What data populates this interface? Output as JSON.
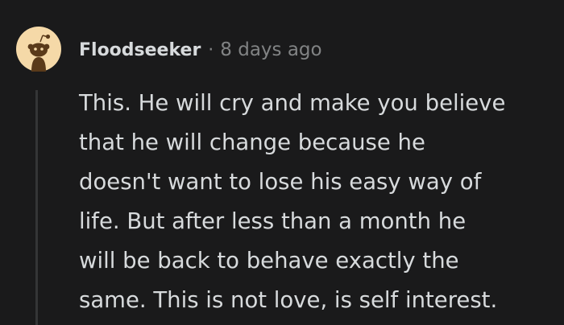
{
  "comment": {
    "avatar_icon": "snoo-avatar-icon",
    "author": "Floodseeker",
    "separator": "·",
    "timestamp": "8 days ago",
    "body_lines": [
      "This. He will cry and make you believe",
      "that he will change because he",
      "doesn't want to lose his easy way of",
      "life. But after less than a month he",
      "will be back to behave exactly the",
      "same. This is not love, is self interest."
    ]
  },
  "colors": {
    "background": "#1a1a1b",
    "text": "#d7dadc",
    "meta_text": "#818384",
    "thread_line": "#343536",
    "avatar_bg": "#f5d9a8"
  }
}
